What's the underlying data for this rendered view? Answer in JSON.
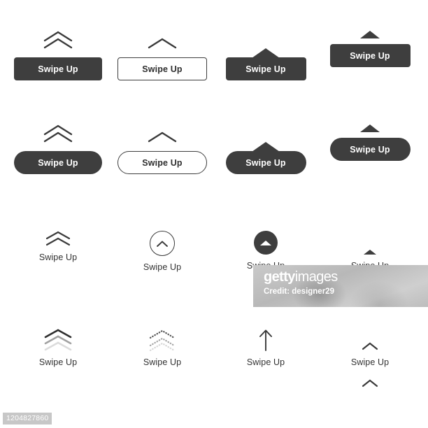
{
  "page": {
    "background_color": "#ffffff",
    "dark_color": "#3e3e3e",
    "text_dark": "#323232",
    "text_light": "#ffffff"
  },
  "label": "Swipe Up",
  "rows": [
    {
      "id": "row-rounded-rect-buttons",
      "items": [
        {
          "id": "r1c1",
          "icon": "double-chevron-up-icon",
          "button": "solid-rounded-button",
          "label": "Swipe Up"
        },
        {
          "id": "r1c2",
          "icon": "chevron-up-icon",
          "button": "outline-rounded-button",
          "label": "Swipe Up"
        },
        {
          "id": "r1c3",
          "icon": "notch-triangle-up-icon",
          "button": "solid-rounded-notched-button",
          "label": "Swipe Up"
        },
        {
          "id": "r1c4",
          "icon": "triangle-up-icon",
          "button": "solid-rounded-button",
          "label": "Swipe Up"
        }
      ]
    },
    {
      "id": "row-pill-buttons",
      "items": [
        {
          "id": "r2c1",
          "icon": "double-chevron-up-icon",
          "button": "solid-pill-button",
          "label": "Swipe Up"
        },
        {
          "id": "r2c2",
          "icon": "chevron-up-icon",
          "button": "outline-pill-button",
          "label": "Swipe Up"
        },
        {
          "id": "r2c3",
          "icon": "notch-triangle-up-icon",
          "button": "solid-pill-notched-button",
          "label": "Swipe Up"
        },
        {
          "id": "r2c4",
          "icon": "triangle-up-icon",
          "button": "solid-pill-button",
          "label": "Swipe Up"
        }
      ]
    },
    {
      "id": "row-plain-icons",
      "items": [
        {
          "id": "r3c1",
          "icon": "double-chevron-up-icon",
          "button": "none",
          "label": "Swipe Up"
        },
        {
          "id": "r3c2",
          "icon": "circle-outline-chevron-up-icon",
          "button": "none",
          "label": "Swipe Up"
        },
        {
          "id": "r3c3",
          "icon": "circle-filled-triangle-up-icon",
          "button": "none",
          "label": "Swipe Up"
        },
        {
          "id": "r3c4",
          "icon": "small-triangle-up-icon",
          "button": "none",
          "label": "Swipe Up"
        }
      ]
    },
    {
      "id": "row-animated-icons",
      "items": [
        {
          "id": "r4c1",
          "icon": "triple-chevron-up-fade-icon",
          "button": "none",
          "label": "Swipe Up"
        },
        {
          "id": "r4c2",
          "icon": "dotted-double-chevron-up-icon",
          "button": "none",
          "label": "Swipe Up"
        },
        {
          "id": "r4c3",
          "icon": "arrow-up-icon",
          "button": "none",
          "label": "Swipe Up"
        },
        {
          "id": "r4c4",
          "icon": "chevron-up-icon",
          "secondary_icon": "chevron-up-icon",
          "button": "none",
          "label": "Swipe Up"
        }
      ]
    }
  ],
  "watermark": {
    "logo_bold": "getty",
    "logo_thin": "images",
    "credit": "Credit: designer29"
  },
  "asset_id": "1204827860"
}
